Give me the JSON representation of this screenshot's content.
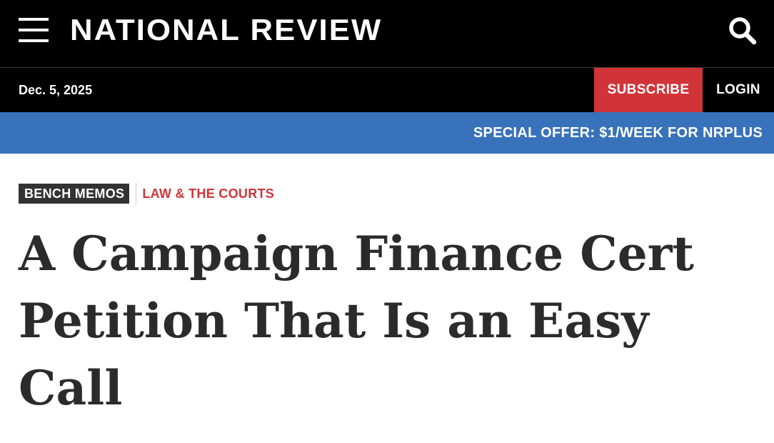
{
  "header": {
    "menu_icon": "hamburger-menu-icon",
    "logo_text": "NATIONAL REVIEW",
    "search_icon": "search-icon"
  },
  "subheader": {
    "date": "Dec. 5, 2025",
    "subscribe_label": "SUBSCRIBE",
    "login_label": "LOGIN"
  },
  "promo": {
    "text": "SPECIAL OFFER: $1/WEEK FOR NRPLUS"
  },
  "article": {
    "tags": {
      "primary": "BENCH MEMOS",
      "secondary": "LAW & THE COURTS"
    },
    "headline": "A Campaign Finance Cert Petition That Is an Easy Call"
  },
  "colors": {
    "header_bg": "#000000",
    "subscribe_bg": "#d13438",
    "promo_bg": "#3872bb",
    "tag_primary_bg": "#333333",
    "tag_secondary_text": "#d13438",
    "headline_text": "#2b2b2b"
  }
}
